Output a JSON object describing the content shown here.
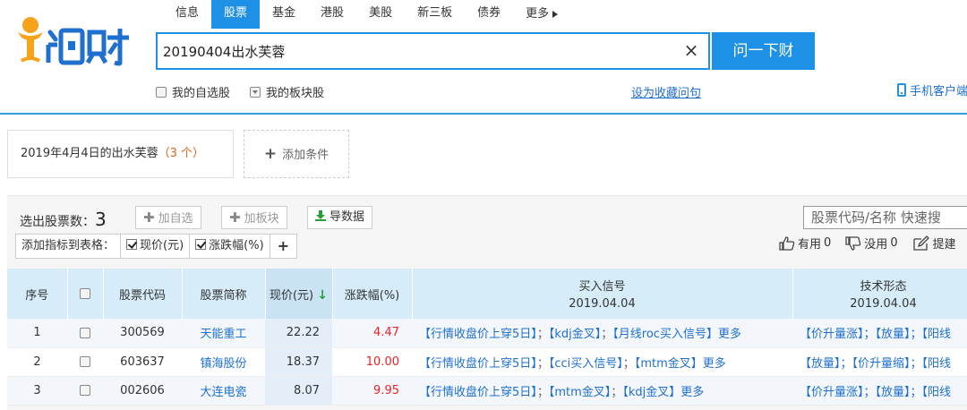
{
  "nav": {
    "items": [
      "信息",
      "股票",
      "基金",
      "港股",
      "美股",
      "新三板",
      "债券"
    ],
    "active_index": 1,
    "more_label": "更多"
  },
  "search": {
    "value": "20190404出水芙蓉",
    "button_label": "问一下财"
  },
  "options": {
    "my_stocks_label": "我的自选股",
    "my_blocks_label": "我的板块股",
    "favorite_link": "设为收藏问句",
    "mobile_link": "手机客户端"
  },
  "condition": {
    "text_prefix": "2019年4月4日的出水芙蓉",
    "count_text": "（3 个）",
    "add_label": "添加条件"
  },
  "toolbar": {
    "result_label": "选出股票数：",
    "result_count": "3",
    "add_watch": "加自选",
    "add_block": "加板块",
    "export": "导数据",
    "indicator_label": "添加指标到表格：",
    "ind_price": "现价(元)",
    "ind_change": "涨跌幅(%)",
    "ind_add": "+",
    "stock_search_placeholder": "股票代码/名称 快速搜",
    "useful_label": "有用",
    "useful_count": "0",
    "useless_label": "没用",
    "useless_count": "0",
    "suggest_label": "提建"
  },
  "colors": {
    "accent": "#1e90e6",
    "header_bg": "#d7ecf9",
    "up_red": "#e22222",
    "link_blue": "#1e6fd0"
  },
  "table": {
    "headers": {
      "index": "序号",
      "code": "股票代码",
      "name": "股票简称",
      "price": "现价(元)",
      "change": "涨跌幅(%)",
      "buy_signal": "买入信号",
      "buy_signal_date": "2019.04.04",
      "tech": "技术形态",
      "tech_date": "2019.04.04"
    },
    "rows": [
      {
        "index": "1",
        "code": "300569",
        "name": "天能重工",
        "price": "22.22",
        "change": "4.47",
        "signals": [
          "行情收盘价上穿5日",
          "kdj金叉",
          "月线roc买入信号"
        ],
        "more": "更多",
        "tech": "【价升量涨】；【放量】；【阳线"
      },
      {
        "index": "2",
        "code": "603637",
        "name": "镇海股份",
        "price": "18.37",
        "change": "10.00",
        "signals": [
          "行情收盘价上穿5日",
          "cci买入信号",
          "mtm金叉"
        ],
        "more": "更多",
        "tech": "【放量】；【价升量缩】；【阳线"
      },
      {
        "index": "3",
        "code": "002606",
        "name": "大连电瓷",
        "price": "8.07",
        "change": "9.95",
        "signals": [
          "行情收盘价上穿5日",
          "mtm金叉",
          "kdj金叉"
        ],
        "more": "更多",
        "tech": "【价升量涨】；【放量】；【阳线"
      }
    ]
  }
}
